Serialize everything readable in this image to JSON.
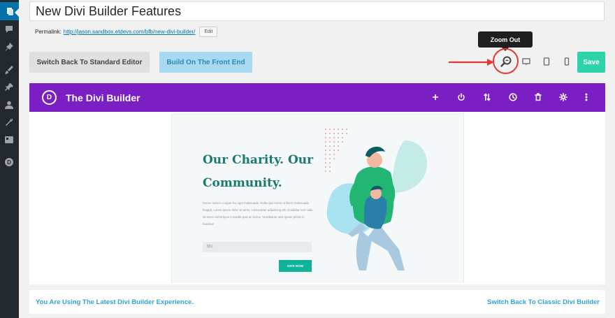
{
  "post": {
    "title": "New Divi Builder Features",
    "permalink_label": "Permalink:",
    "permalink_base": "http://jason.sandbox.etdevs.com/bfb/",
    "permalink_slug": "new-divi-builder",
    "permalink_suffix": "/",
    "edit_label": "Edit"
  },
  "toolbar": {
    "standard_editor_label": "Switch Back To Standard Editor",
    "front_end_label": "Build On The Front End",
    "tooltip": "Zoom Out",
    "save_label": "Save"
  },
  "builder": {
    "logo_letter": "D",
    "title": "The Divi Builder",
    "bar_icons": [
      "plus-icon",
      "power-icon",
      "sort-icon",
      "history-icon",
      "trash-icon",
      "gear-icon",
      "more-icon"
    ]
  },
  "preview": {
    "headline": "Our Charity. Our Community.",
    "body": "Donec rutrum congue leo eget malesuada. Nulla quis lorem ut libero malesuada feugiat. Lorem ipsum dolor sit amet, consectetur adipiscing elit. Curabitur non nulla sit amet nisl tempus convallis quis ac lectus. Vestibulum ante ipsum primis in faucibus",
    "amount_placeholder": "$50",
    "give_label": "GIVE NOW"
  },
  "footer": {
    "left_text": "You Are Using The Latest Divi Builder Experience.",
    "right_link": "Switch Back To Classic Divi Builder"
  },
  "colors": {
    "builder_bar": "#7b1fc5",
    "save": "#2ed3aa",
    "highlight": "#e53935",
    "headline": "#1a7a6c"
  }
}
